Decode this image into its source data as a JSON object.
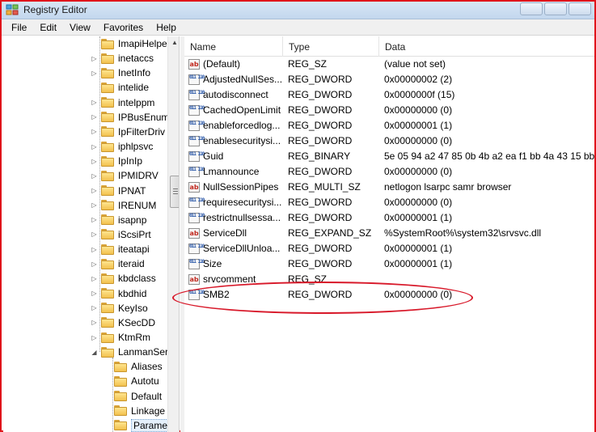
{
  "window": {
    "title": "Registry Editor"
  },
  "menu": [
    "File",
    "Edit",
    "View",
    "Favorites",
    "Help"
  ],
  "tree": {
    "items": [
      {
        "label": "ImapiHelpe",
        "expander": ""
      },
      {
        "label": "inetaccs",
        "expander": "▷"
      },
      {
        "label": "InetInfo",
        "expander": "▷"
      },
      {
        "label": "intelide",
        "expander": ""
      },
      {
        "label": "intelppm",
        "expander": "▷"
      },
      {
        "label": "IPBusEnum",
        "expander": "▷"
      },
      {
        "label": "IpFilterDriv",
        "expander": "▷"
      },
      {
        "label": "iphlpsvc",
        "expander": "▷"
      },
      {
        "label": "IpInIp",
        "expander": "▷"
      },
      {
        "label": "IPMIDRV",
        "expander": "▷"
      },
      {
        "label": "IPNAT",
        "expander": "▷"
      },
      {
        "label": "IRENUM",
        "expander": "▷"
      },
      {
        "label": "isapnp",
        "expander": "▷"
      },
      {
        "label": "iScsiPrt",
        "expander": "▷"
      },
      {
        "label": "iteatapi",
        "expander": "▷"
      },
      {
        "label": "iteraid",
        "expander": "▷"
      },
      {
        "label": "kbdclass",
        "expander": "▷"
      },
      {
        "label": "kbdhid",
        "expander": "▷"
      },
      {
        "label": "KeyIso",
        "expander": "▷"
      },
      {
        "label": "KSecDD",
        "expander": "▷"
      },
      {
        "label": "KtmRm",
        "expander": "▷"
      },
      {
        "label": "LanmanSer",
        "expander": "◢"
      }
    ],
    "children": [
      {
        "label": "Aliases",
        "expander": ""
      },
      {
        "label": "Autotu",
        "expander": ""
      },
      {
        "label": "Default",
        "expander": ""
      },
      {
        "label": "Linkage",
        "expander": ""
      },
      {
        "label": "Parame",
        "expander": ""
      }
    ]
  },
  "columns": {
    "name": "Name",
    "type": "Type",
    "data": "Data"
  },
  "values": [
    {
      "name": "(Default)",
      "type": "REG_SZ",
      "data": "(value not set)",
      "icon": "string-value-icon"
    },
    {
      "name": "AdjustedNullSes...",
      "type": "REG_DWORD",
      "data": "0x00000002 (2)",
      "icon": "binary-value-icon"
    },
    {
      "name": "autodisconnect",
      "type": "REG_DWORD",
      "data": "0x0000000f (15)",
      "icon": "binary-value-icon"
    },
    {
      "name": "CachedOpenLimit",
      "type": "REG_DWORD",
      "data": "0x00000000 (0)",
      "icon": "binary-value-icon"
    },
    {
      "name": "enableforcedlog...",
      "type": "REG_DWORD",
      "data": "0x00000001 (1)",
      "icon": "binary-value-icon"
    },
    {
      "name": "enablesecuritysi...",
      "type": "REG_DWORD",
      "data": "0x00000000 (0)",
      "icon": "binary-value-icon"
    },
    {
      "name": "Guid",
      "type": "REG_BINARY",
      "data": "5e 05 94 a2 47 85 0b 4b a2 ea f1 bb 4a 43 15 bb",
      "icon": "binary-value-icon"
    },
    {
      "name": "Lmannounce",
      "type": "REG_DWORD",
      "data": "0x00000000 (0)",
      "icon": "binary-value-icon"
    },
    {
      "name": "NullSessionPipes",
      "type": "REG_MULTI_SZ",
      "data": "netlogon lsarpc samr browser",
      "icon": "string-value-icon"
    },
    {
      "name": "requiresecuritysi...",
      "type": "REG_DWORD",
      "data": "0x00000000 (0)",
      "icon": "binary-value-icon"
    },
    {
      "name": "restrictnullsessa...",
      "type": "REG_DWORD",
      "data": "0x00000001 (1)",
      "icon": "binary-value-icon"
    },
    {
      "name": "ServiceDll",
      "type": "REG_EXPAND_SZ",
      "data": "%SystemRoot%\\system32\\srvsvc.dll",
      "icon": "string-value-icon"
    },
    {
      "name": "ServiceDllUnloa...",
      "type": "REG_DWORD",
      "data": "0x00000001 (1)",
      "icon": "binary-value-icon"
    },
    {
      "name": "Size",
      "type": "REG_DWORD",
      "data": "0x00000001 (1)",
      "icon": "binary-value-icon"
    },
    {
      "name": "srvcomment",
      "type": "REG_SZ",
      "data": "",
      "icon": "string-value-icon"
    },
    {
      "name": "SMB2",
      "type": "REG_DWORD",
      "data": "0x00000000 (0)",
      "icon": "binary-value-icon"
    }
  ],
  "colors": {
    "frame_border": "#e0141b",
    "highlight_ellipse": "#d8192a"
  }
}
